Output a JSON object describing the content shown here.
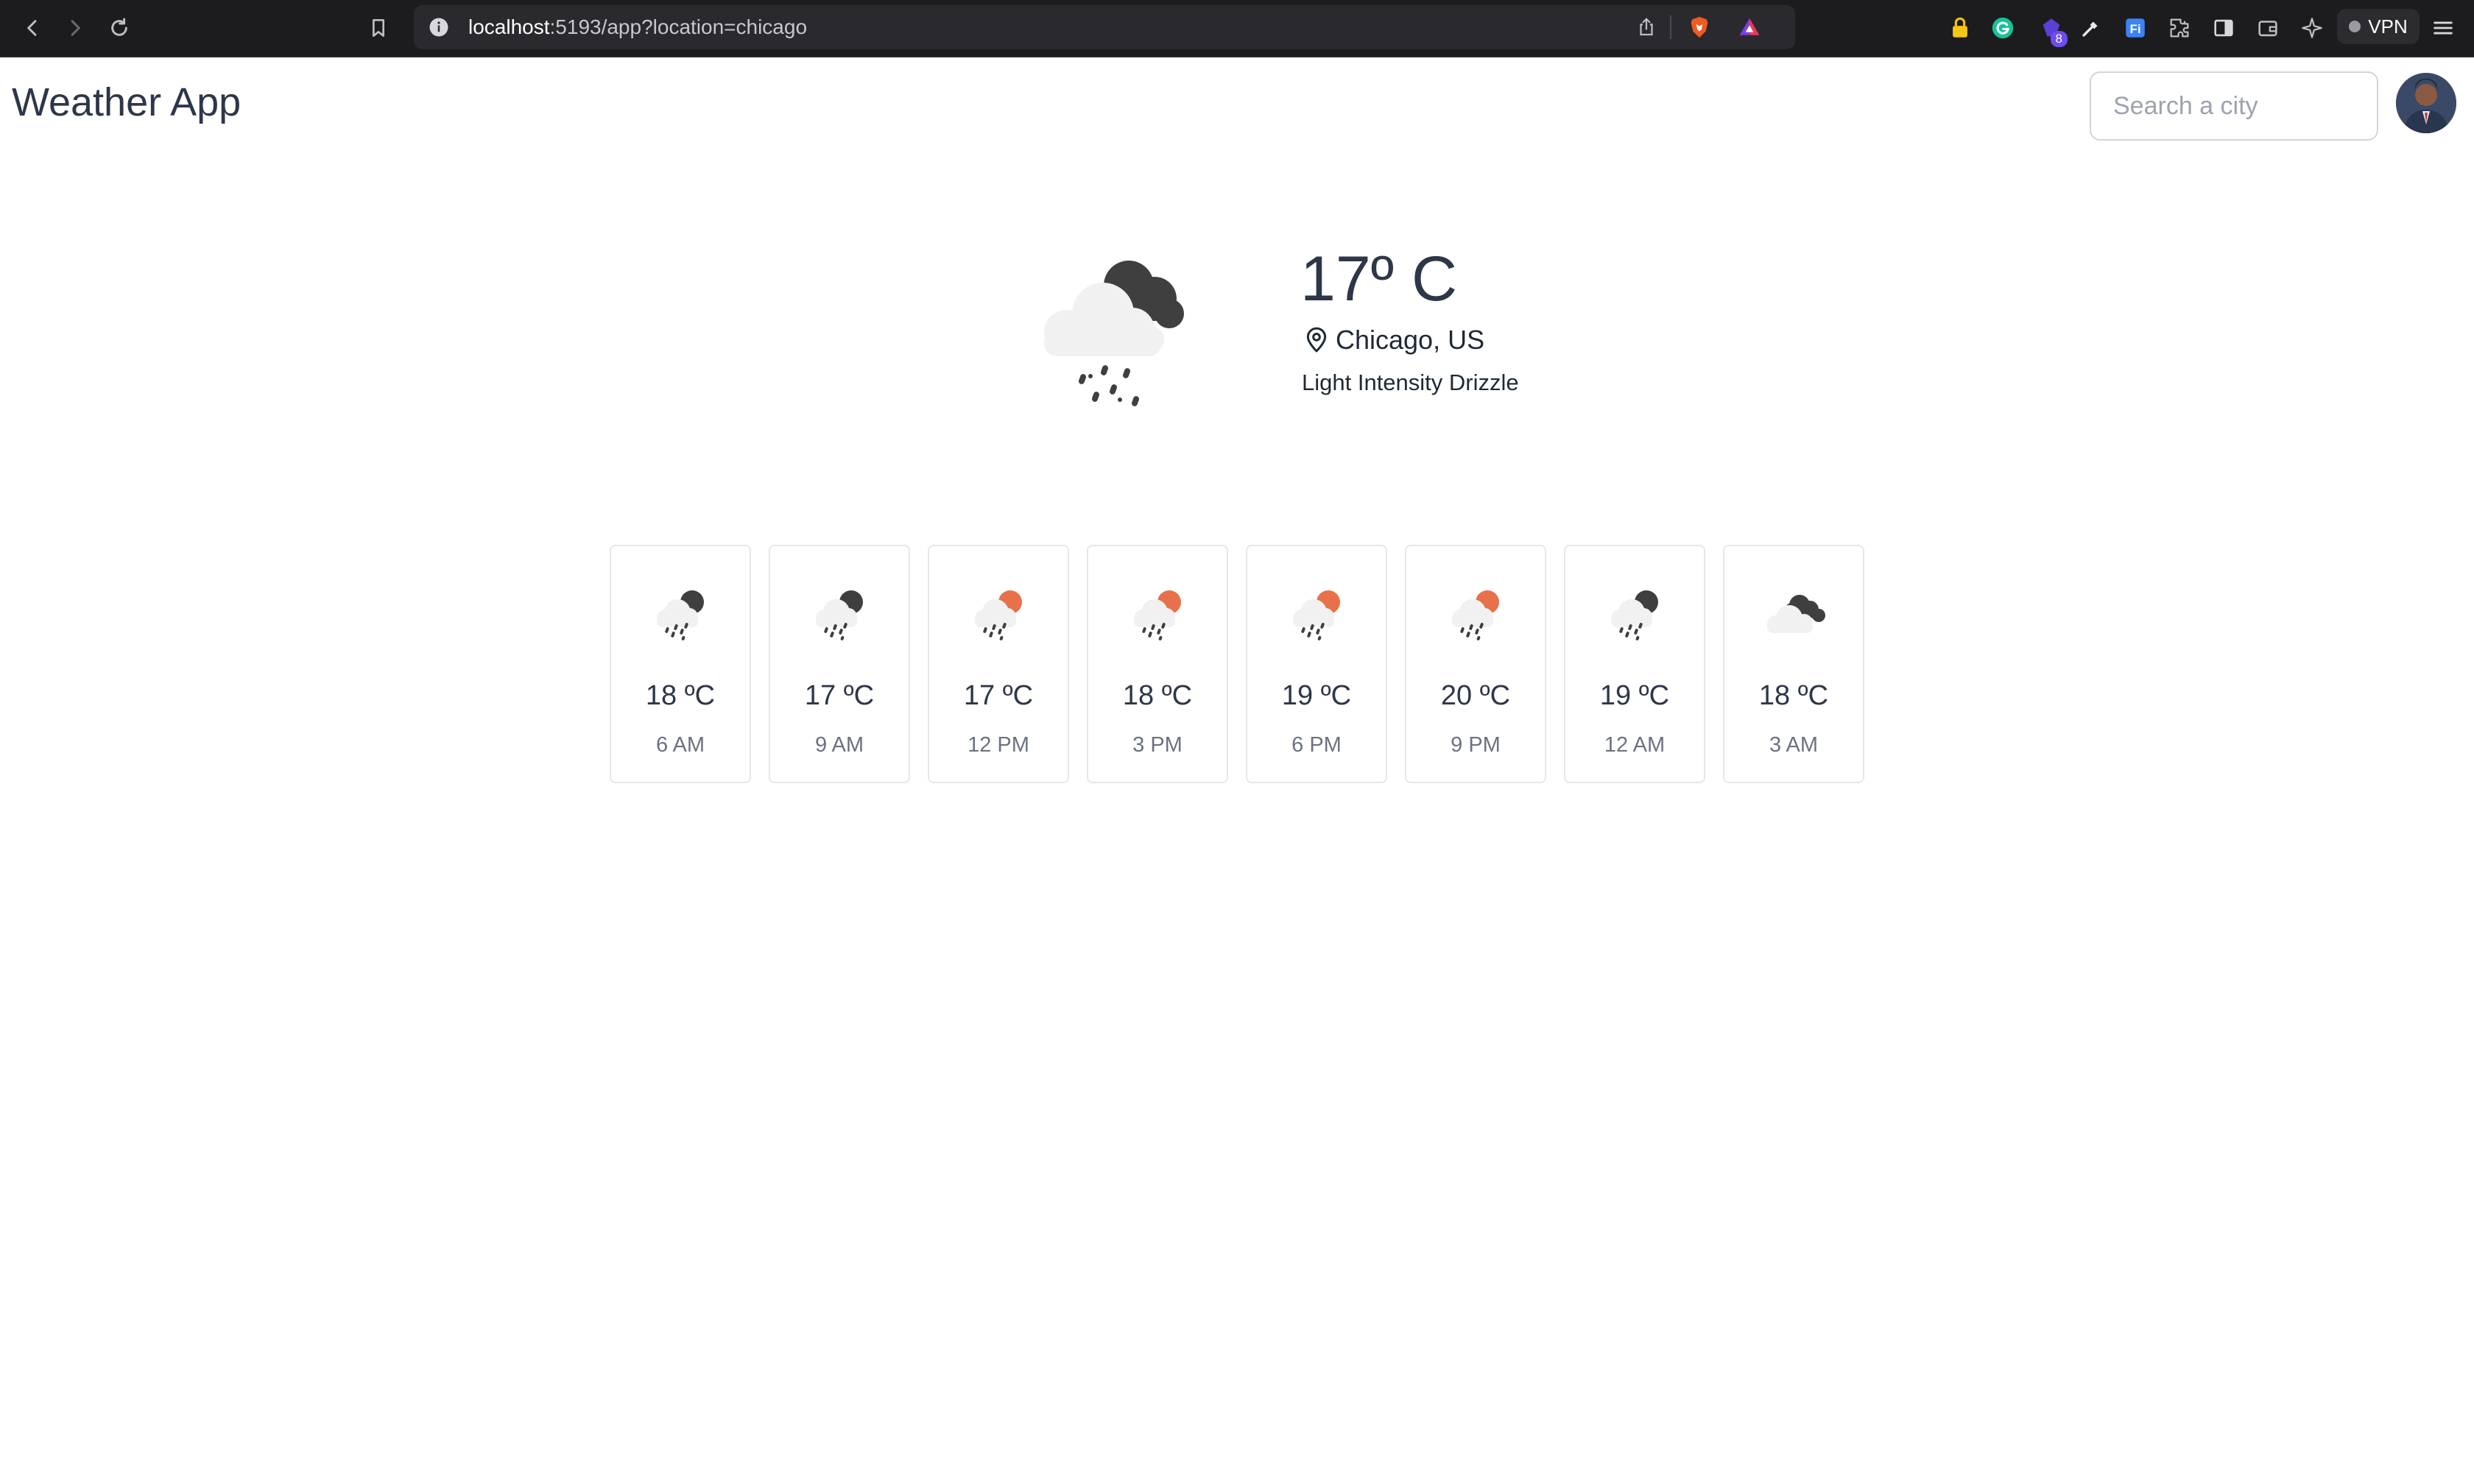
{
  "browser": {
    "url_host": "localhost",
    "url_rest": ":5193/app?location=chicago",
    "extension_badge": "8",
    "vpn_label": "VPN"
  },
  "app": {
    "title": "Weather App",
    "search_placeholder": "Search a city"
  },
  "current": {
    "temperature": "17º C",
    "location": "Chicago, US",
    "description": "Light Intensity Drizzle",
    "icon": "rain-cloud-night-icon"
  },
  "forecast": [
    {
      "temp": "18 ºC",
      "time": "6 AM",
      "icon": "rain-night-icon"
    },
    {
      "temp": "17 ºC",
      "time": "9 AM",
      "icon": "rain-night-icon"
    },
    {
      "temp": "17 ºC",
      "time": "12 PM",
      "icon": "rain-day-icon"
    },
    {
      "temp": "18 ºC",
      "time": "3 PM",
      "icon": "rain-day-icon"
    },
    {
      "temp": "19 ºC",
      "time": "6 PM",
      "icon": "rain-day-icon"
    },
    {
      "temp": "20 ºC",
      "time": "9 PM",
      "icon": "rain-day-icon"
    },
    {
      "temp": "19 ºC",
      "time": "12 AM",
      "icon": "rain-night-icon"
    },
    {
      "temp": "18 ºC",
      "time": "3 AM",
      "icon": "cloudy-icon"
    }
  ],
  "colors": {
    "sun": "#e8704a",
    "dark_cloud": "#3f3f3f",
    "light_cloud": "#f1f1f1",
    "text": "#2d3748",
    "muted": "#6b7280"
  }
}
